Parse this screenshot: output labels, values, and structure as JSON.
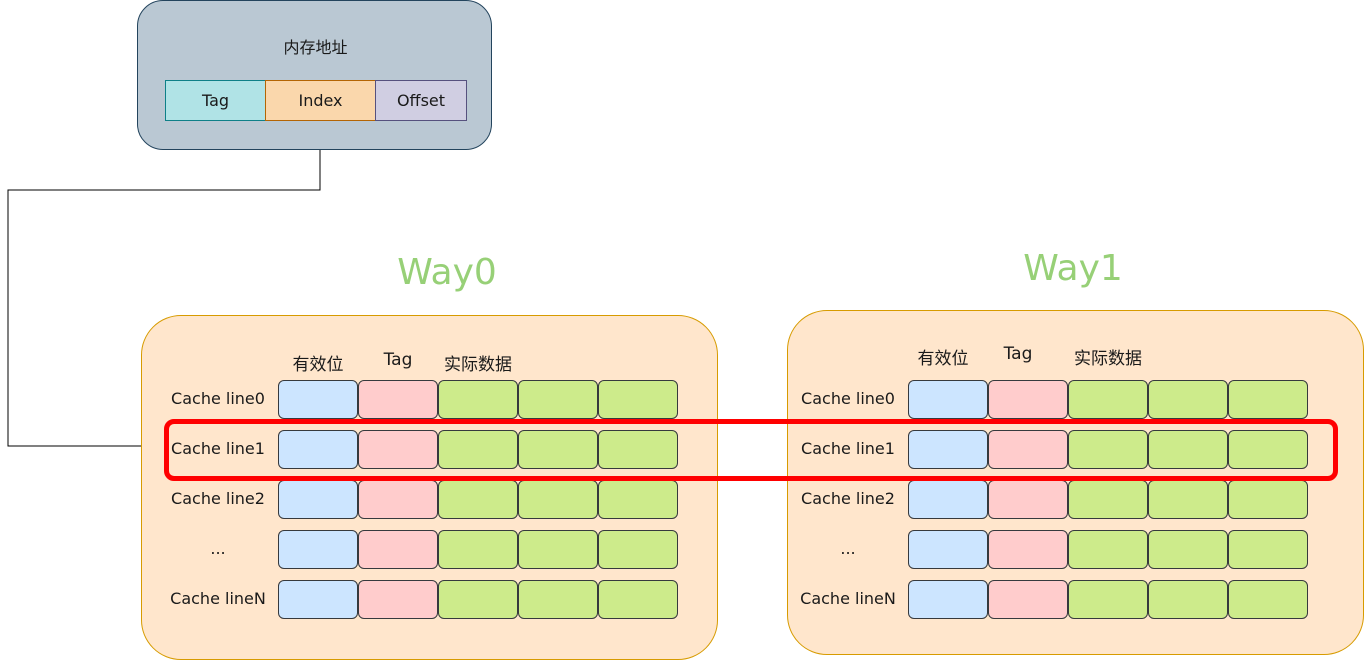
{
  "memory_address": {
    "title": "内存地址",
    "fields": {
      "tag": "Tag",
      "index": "Index",
      "offset": "Offset"
    }
  },
  "ways": [
    {
      "title": "Way0",
      "headers": {
        "valid": "有效位",
        "tag": "Tag",
        "data": "实际数据"
      },
      "rows": [
        "Cache line0",
        "Cache line1",
        "Cache line2",
        "...",
        "Cache lineN"
      ]
    },
    {
      "title": "Way1",
      "headers": {
        "valid": "有效位",
        "tag": "Tag",
        "data": "实际数据"
      },
      "rows": [
        "Cache line0",
        "Cache line1",
        "Cache line2",
        "...",
        "Cache lineN"
      ]
    }
  ],
  "colors": {
    "address_box": "#bac8d3",
    "way_box": "#ffe6cc",
    "way_title": "#97d077",
    "valid_cell": "#cce5ff",
    "tag_cell": "#ffcccc",
    "data_cell": "#cdeb8b",
    "highlight": "#ff0000"
  },
  "highlighted_row": "Cache line1"
}
